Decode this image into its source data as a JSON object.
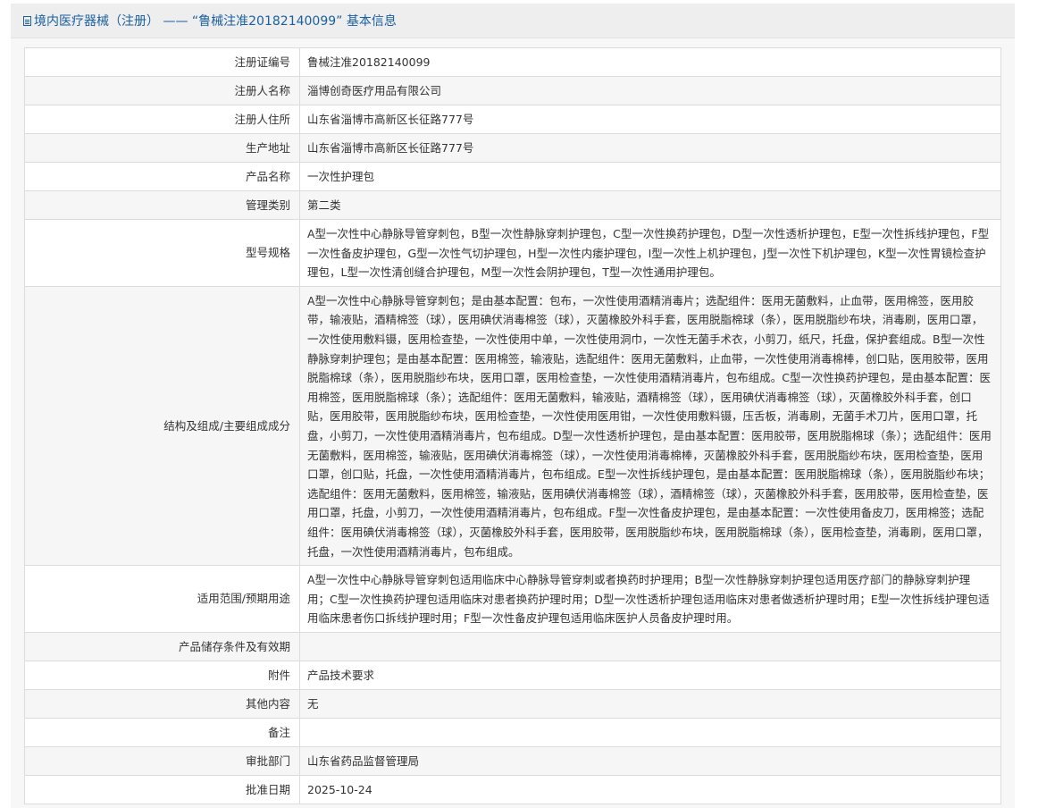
{
  "header": {
    "title": "境内医疗器械（注册） —— “鲁械注准20182140099” 基本信息"
  },
  "rows": [
    {
      "label": "注册证编号",
      "value": "鲁械注准20182140099"
    },
    {
      "label": "注册人名称",
      "value": "淄博创奇医疗用品有限公司"
    },
    {
      "label": "注册人住所",
      "value": "山东省淄博市高新区长征路777号"
    },
    {
      "label": "生产地址",
      "value": "山东省淄博市高新区长征路777号"
    },
    {
      "label": "产品名称",
      "value": "一次性护理包"
    },
    {
      "label": "管理类别",
      "value": "第二类"
    },
    {
      "label": "型号规格",
      "value": "A型一次性中心静脉导管穿刺包，B型一次性静脉穿刺护理包，C型一次性换药护理包，D型一次性透析护理包，E型一次性拆线护理包，F型一次性备皮护理包，G型一次性气切护理包，H型一次性内瘘护理包，I型一次性上机护理包，J型一次性下机护理包，K型一次性胃镜检查护理包，L型一次性清创缝合护理包，M型一次性会阴护理包，T型一次性通用护理包。"
    },
    {
      "label": "结构及组成/主要组成成分",
      "value": "A型一次性中心静脉导管穿刺包；是由基本配置：包布，一次性使用酒精消毒片；选配组件：医用无菌敷料，止血带，医用棉签，医用胶带，输液贴，酒精棉签（球），医用碘伏消毒棉签（球），灭菌橡胶外科手套，医用脱脂棉球（条），医用脱脂纱布块，消毒刷，医用口罩，一次性使用敷料镊，医用检查垫，一次性使用中单，一次性使用洞巾，一次性无菌手术衣，小剪刀，纸尺，托盘，保护套组成。B型一次性静脉穿刺护理包；是由基本配置：医用棉签，输液贴，选配组件：医用无菌敷料，止血带，一次性使用消毒棉棒，创口贴，医用胶带，医用脱脂棉球（条），医用脱脂纱布块，医用口罩，医用检查垫，一次性使用酒精消毒片，包布组成。C型一次性换药护理包，是由基本配置：医用棉签，医用脱脂棉球（条）；选配组件：医用无菌敷料，输液贴，酒精棉签（球），医用碘伏消毒棉签（球），灭菌橡胶外科手套，创口贴，医用胶带，医用脱脂纱布块，医用检查垫，一次性使用医用钳，一次性使用敷料镊，压舌板，消毒刷，无菌手术刀片，医用口罩，托盘，小剪刀，一次性使用酒精消毒片，包布组成。D型一次性透析护理包，是由基本配置：医用胶带，医用脱脂棉球（条）；选配组件：医用无菌敷料，医用棉签，输液贴，医用碘伏消毒棉签（球），一次性使用消毒棉棒，灭菌橡胶外科手套，医用脱脂纱布块，医用检查垫，医用口罩，创口贴，托盘，一次性使用酒精消毒片，包布组成。E型一次性拆线护理包，是由基本配置：医用脱脂棉球（条），医用脱脂纱布块；选配组件：医用无菌敷料，医用棉签，输液贴，医用碘伏消毒棉签（球），酒精棉签（球），灭菌橡胶外科手套，医用胶带，医用检查垫，医用口罩，托盘，小剪刀，一次性使用酒精消毒片，包布组成。F型一次性备皮护理包，是由基本配置：一次性使用备皮刀，医用棉签；选配组件：医用碘伏消毒棉签（球），灭菌橡胶外科手套，医用胶带，医用脱脂纱布块，医用脱脂棉球（条），医用检查垫，消毒刷，医用口罩，托盘，一次性使用酒精消毒片，包布组成。"
    },
    {
      "label": "适用范围/预期用途",
      "value": "A型一次性中心静脉导管穿刺包适用临床中心静脉导管穿刺或者换药时护理用；B型一次性静脉穿刺护理包适用医疗部门的静脉穿刺护理用；C型一次性换药护理包适用临床对患者换药护理时用；D型一次性透析护理包适用临床对患者做透析护理时用；E型一次性拆线护理包适用临床患者伤口拆线护理时用；F型一次性备皮护理包适用临床医护人员备皮护理时用。"
    },
    {
      "label": "产品储存条件及有效期",
      "value": ""
    },
    {
      "label": "附件",
      "value": "产品技术要求"
    },
    {
      "label": "其他内容",
      "value": "无"
    },
    {
      "label": "备注",
      "value": ""
    },
    {
      "label": "审批部门",
      "value": "山东省药品监督管理局"
    },
    {
      "label": "批准日期",
      "value": "2025-10-24"
    }
  ]
}
